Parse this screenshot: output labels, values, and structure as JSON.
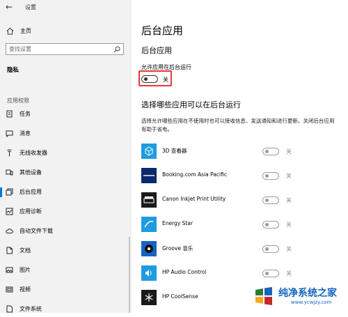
{
  "window": {
    "back_glyph": "←",
    "title": "设置"
  },
  "sidebar": {
    "home_label": "主页",
    "search_placeholder": "查找设置",
    "privacy_heading": "隐私",
    "section_heading": "应用权限",
    "items": [
      {
        "label": "任务",
        "icon": "tasks-icon"
      },
      {
        "label": "消息",
        "icon": "message-icon"
      },
      {
        "label": "无线收发器",
        "icon": "radio-icon"
      },
      {
        "label": "其他设备",
        "icon": "devices-icon"
      },
      {
        "label": "后台应用",
        "icon": "background-apps-icon",
        "active": true
      },
      {
        "label": "应用诊断",
        "icon": "diagnostics-icon"
      },
      {
        "label": "自动文件下载",
        "icon": "cloud-icon"
      },
      {
        "label": "文档",
        "icon": "document-icon"
      },
      {
        "label": "图片",
        "icon": "picture-icon"
      },
      {
        "label": "视频",
        "icon": "video-icon"
      },
      {
        "label": "文件系统",
        "icon": "file-system-icon"
      }
    ]
  },
  "main": {
    "page_title": "后台应用",
    "section1_title": "后台应用",
    "allow_label": "允许应用在后台运行",
    "allow_state": "关",
    "section2_title": "选择哪些应用可以在后台运行",
    "description": "选择允许哪些应用在不使用时也可以接收信息、发送通知和进行更新。关闭后台应用有助于省电。",
    "apps": [
      {
        "name": "3D 查看器",
        "state": "关",
        "icon": "3d-viewer-icon",
        "color": "#1e9ce0"
      },
      {
        "name": "Booking.com Asia Pacific",
        "state": "关",
        "icon": "booking-icon",
        "color": "#0c2a6b"
      },
      {
        "name": "Canon Inkjet Print Utility",
        "state": "关",
        "icon": "printer-icon",
        "color": "#1a1a1a"
      },
      {
        "name": "Energy Star",
        "state": "关",
        "icon": "energy-star-icon",
        "color": "#1e9ce0"
      },
      {
        "name": "Groove 音乐",
        "state": "关",
        "icon": "groove-music-icon",
        "color": "#1565c0"
      },
      {
        "name": "HP Audio Control",
        "state": "关",
        "icon": "audio-icon",
        "color": "#1e9ce0"
      },
      {
        "name": "HP CoolSense",
        "state": "关",
        "icon": "snowflake-icon",
        "color": "#1a1a1a"
      }
    ]
  },
  "watermark": {
    "text": "纯净系统之家",
    "url": "www.ycwjzy.com"
  }
}
